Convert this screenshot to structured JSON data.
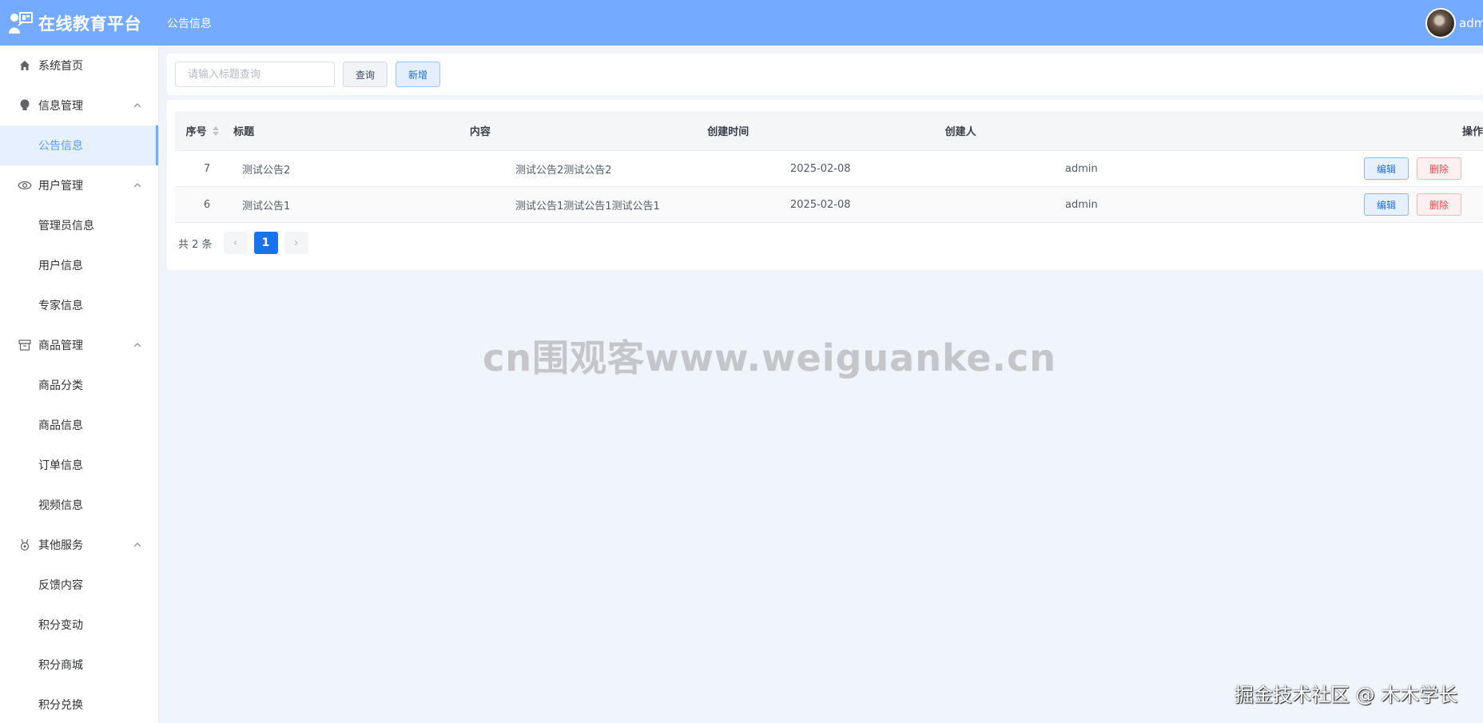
{
  "app": {
    "title": "在线教育平台",
    "breadcrumb": "公告信息",
    "user_name": "adm"
  },
  "sidebar": {
    "home": "系统首页",
    "groups": [
      {
        "label": "信息管理",
        "items": [
          "公告信息"
        ]
      },
      {
        "label": "用户管理",
        "items": [
          "管理员信息",
          "用户信息",
          "专家信息"
        ]
      },
      {
        "label": "商品管理",
        "items": [
          "商品分类",
          "商品信息",
          "订单信息",
          "视频信息"
        ]
      },
      {
        "label": "其他服务",
        "items": [
          "反馈内容",
          "积分变动",
          "积分商城",
          "积分兑换"
        ]
      }
    ],
    "active_item": "公告信息"
  },
  "search": {
    "placeholder": "请输入标题查询",
    "query_label": "查询",
    "add_label": "新增"
  },
  "table": {
    "columns": [
      "序号",
      "标题",
      "内容",
      "创建时间",
      "创建人",
      "操作"
    ],
    "rows": [
      {
        "no": "7",
        "title": "测试公告2",
        "content": "测试公告2测试公告2",
        "time": "2025-02-08",
        "user": "admin"
      },
      {
        "no": "6",
        "title": "测试公告1",
        "content": "测试公告1测试公告1测试公告1",
        "time": "2025-02-08",
        "user": "admin"
      }
    ],
    "edit_label": "编辑",
    "delete_label": "删除"
  },
  "pagination": {
    "total_text": "共 2 条",
    "prev": "‹",
    "current": "1",
    "next": "›"
  },
  "watermarks": {
    "center": "cn围观客www.weiguanke.cn",
    "corner": "掘金技术社区 @ 木木学长"
  },
  "colors": {
    "header": "#74aaff",
    "accent": "#1a73e8",
    "danger": "#e54848",
    "background": "#f0f4fb"
  }
}
